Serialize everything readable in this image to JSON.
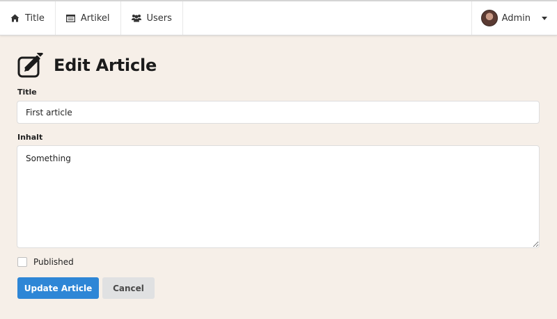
{
  "nav": {
    "items": [
      {
        "label": "Title",
        "icon": "home-icon"
      },
      {
        "label": "Artikel",
        "icon": "list-icon"
      },
      {
        "label": "Users",
        "icon": "users-icon"
      }
    ],
    "user": {
      "name": "Admin"
    }
  },
  "page": {
    "title": "Edit Article",
    "icon": "edit-icon"
  },
  "form": {
    "title_label": "Title",
    "title_value": "First article",
    "content_label": "Inhalt",
    "content_value": "Something",
    "published_label": "Published",
    "published_checked": false,
    "submit_label": "Update Article",
    "cancel_label": "Cancel"
  },
  "colors": {
    "background": "#f6efe8",
    "primary": "#2e86d6",
    "secondary": "#e0e1e2"
  }
}
